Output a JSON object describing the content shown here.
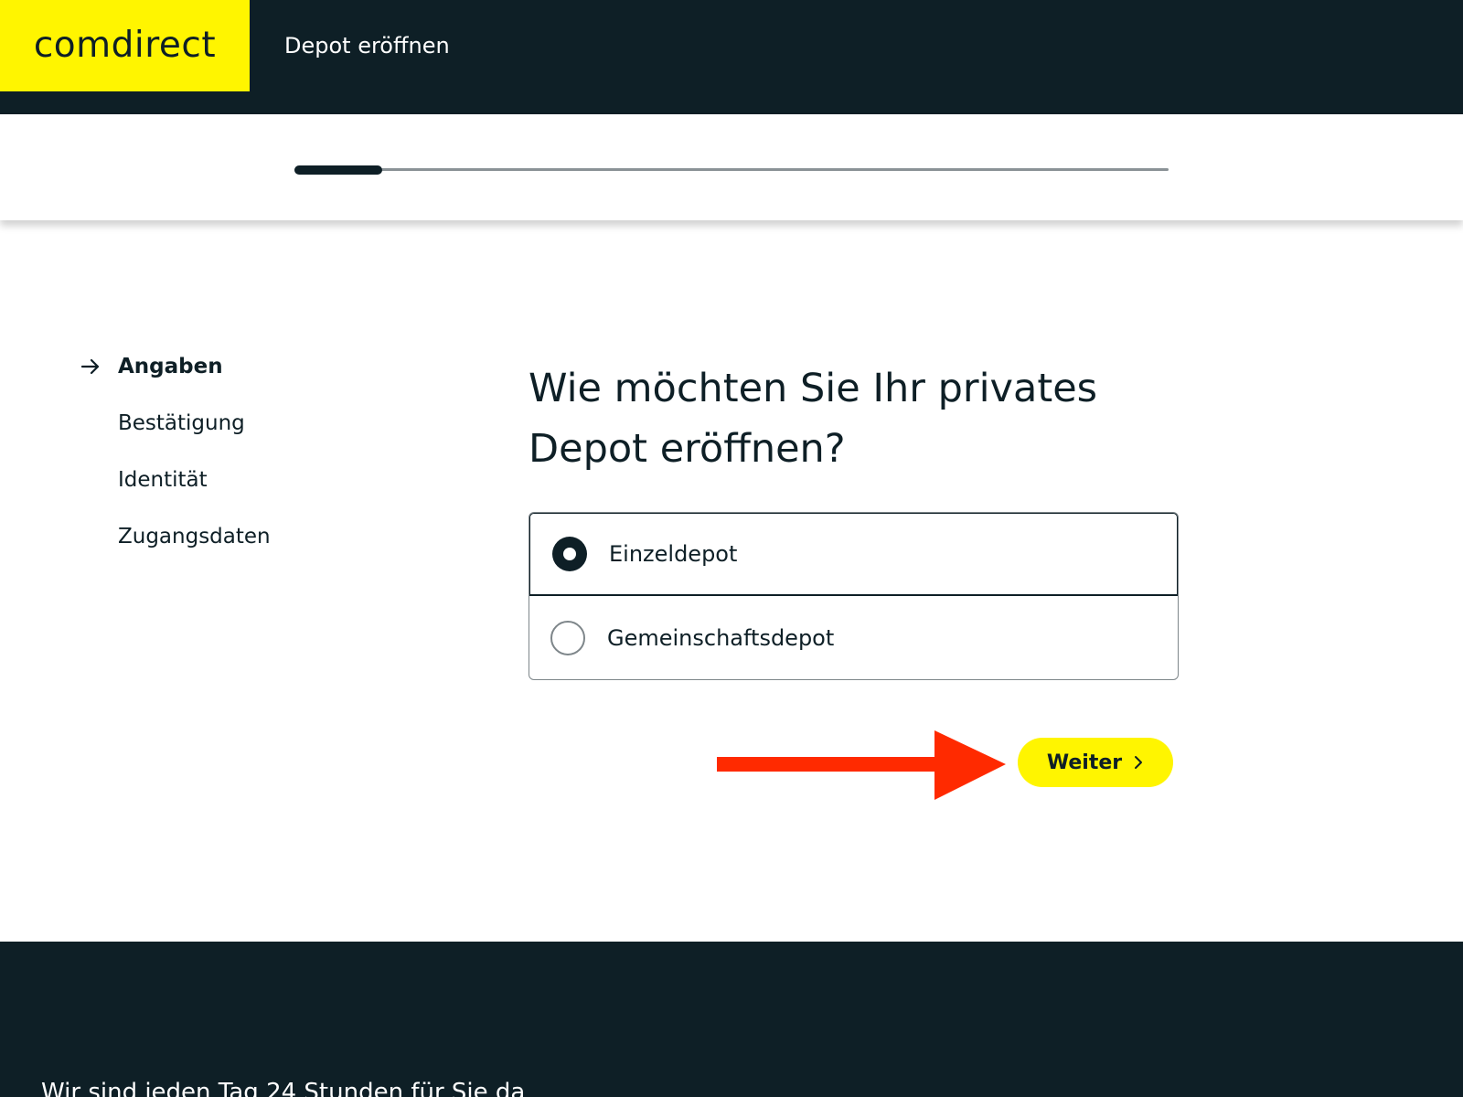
{
  "header": {
    "logo_text": "comdirect",
    "title": "Depot eröffnen"
  },
  "progress": {
    "fraction": 0.1
  },
  "steps": [
    {
      "label": "Angaben",
      "active": true
    },
    {
      "label": "Bestätigung",
      "active": false
    },
    {
      "label": "Identität",
      "active": false
    },
    {
      "label": "Zugangsdaten",
      "active": false
    }
  ],
  "question": {
    "line1": "Wie möchten Sie Ihr privates",
    "line2": "Depot eröffnen?"
  },
  "options": [
    {
      "label": "Einzeldepot",
      "selected": true
    },
    {
      "label": "Gemeinschaftsdepot",
      "selected": false
    }
  ],
  "button": {
    "label": "Weiter",
    "icon": "chevron-right-icon"
  },
  "annotation": {
    "icon": "red-arrow-icon",
    "color": "#ff2a00"
  },
  "footer": {
    "text": "Wir sind jeden Tag 24 Stunden für Sie da"
  },
  "colors": {
    "brand_yellow": "#fff500",
    "dark": "#0e1f26"
  }
}
